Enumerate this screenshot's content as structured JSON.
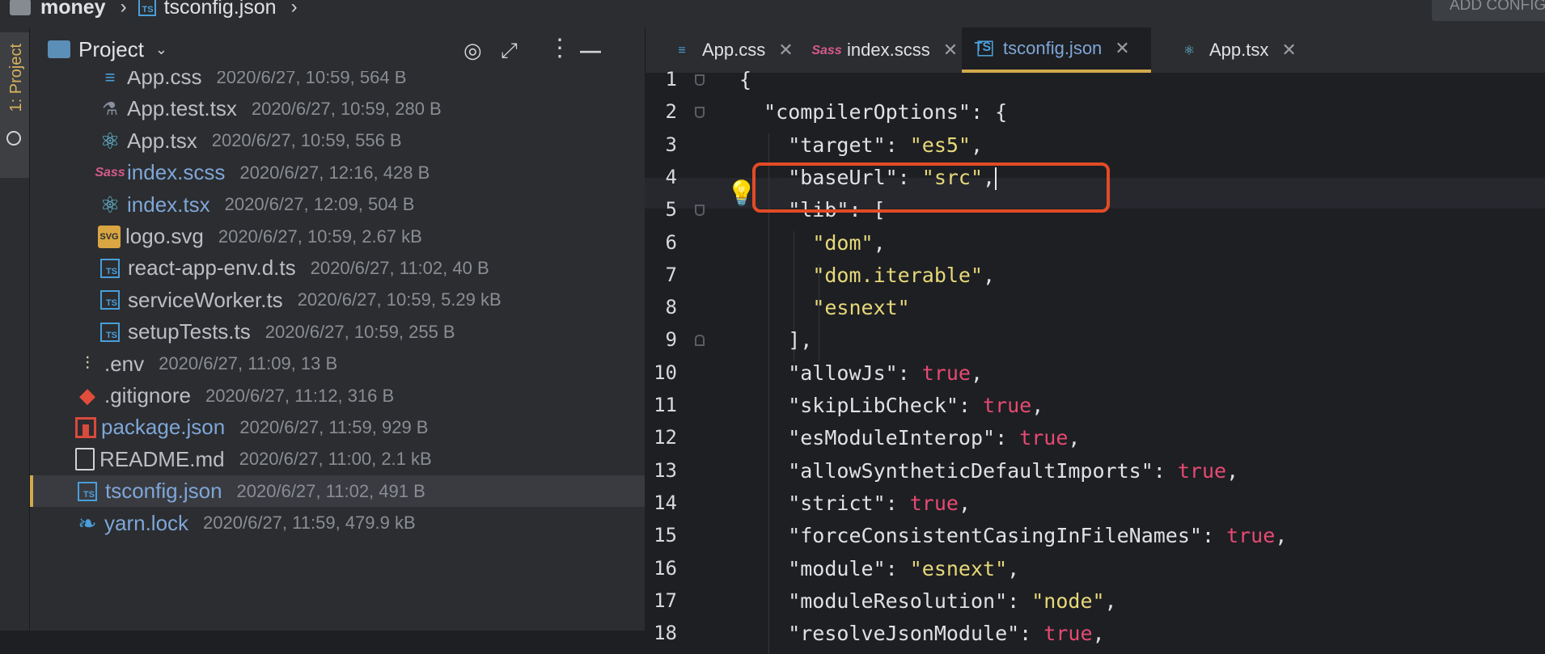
{
  "breadcrumb": {
    "project": "money",
    "file": "tsconfig.json",
    "ts_badge": "TS"
  },
  "toolbar": {
    "add_config": "ADD CONFIGURATION"
  },
  "tool_strip": {
    "project_label": "1: Project"
  },
  "project_panel": {
    "title": "Project"
  },
  "tree": [
    {
      "name": "App.css",
      "meta": "2020/6/27, 10:59, 564 B",
      "icon": "css-icon",
      "color": "#bcbec4"
    },
    {
      "name": "App.test.tsx",
      "meta": "2020/6/27, 10:59, 280 B",
      "icon": "flask-icon",
      "color": "#bcbec4"
    },
    {
      "name": "App.tsx",
      "meta": "2020/6/27, 10:59, 556 B",
      "icon": "react-icon",
      "color": "#bcbec4"
    },
    {
      "name": "index.scss",
      "meta": "2020/6/27, 12:16, 428 B",
      "icon": "sass-icon",
      "color": "#7fa6d8"
    },
    {
      "name": "index.tsx",
      "meta": "2020/6/27, 12:09, 504 B",
      "icon": "react-icon",
      "color": "#7fa6d8"
    },
    {
      "name": "logo.svg",
      "meta": "2020/6/27, 10:59, 2.67 kB",
      "icon": "svg-icon",
      "color": "#bcbec4"
    },
    {
      "name": "react-app-env.d.ts",
      "meta": "2020/6/27, 11:02, 40 B",
      "icon": "typescript-icon",
      "color": "#bcbec4"
    },
    {
      "name": "serviceWorker.ts",
      "meta": "2020/6/27, 10:59, 5.29 kB",
      "icon": "typescript-icon",
      "color": "#bcbec4"
    },
    {
      "name": "setupTests.ts",
      "meta": "2020/6/27, 10:59, 255 B",
      "icon": "typescript-icon",
      "color": "#bcbec4"
    },
    {
      "name": ".env",
      "meta": "2020/6/27, 11:09, 13 B",
      "icon": "settings-sliders-icon",
      "color": "#bcbec4"
    },
    {
      "name": ".gitignore",
      "meta": "2020/6/27, 11:12, 316 B",
      "icon": "git-icon",
      "color": "#bcbec4"
    },
    {
      "name": "package.json",
      "meta": "2020/6/27, 11:59, 929 B",
      "icon": "npm-package-icon",
      "color": "#7fa6d8"
    },
    {
      "name": "README.md",
      "meta": "2020/6/27, 11:00, 2.1 kB",
      "icon": "book-icon",
      "color": "#bcbec4"
    },
    {
      "name": "tsconfig.json",
      "meta": "2020/6/27, 11:02, 491 B",
      "icon": "typescript-icon",
      "color": "#7fa6d8",
      "selected": true
    },
    {
      "name": "yarn.lock",
      "meta": "2020/6/27, 11:59, 479.9 kB",
      "icon": "yarn-icon",
      "color": "#7fa6d8"
    }
  ],
  "icon_glyphs": {
    "ts_badge": "TS",
    "svg_badge": "SVG",
    "sass_badge": "Sass"
  },
  "tabs": [
    {
      "label": "App.css",
      "icon": "css-icon"
    },
    {
      "label": "index.scss",
      "icon": "sass-icon"
    },
    {
      "label": "tsconfig.json",
      "icon": "typescript-icon",
      "active": true
    },
    {
      "label": "App.tsx",
      "icon": "react-icon"
    }
  ],
  "editor": {
    "current_line": 4,
    "line_numbers": [
      "1",
      "2",
      "3",
      "4",
      "5",
      "6",
      "7",
      "8",
      "9",
      "10",
      "11",
      "12",
      "13",
      "14",
      "15",
      "16",
      "17",
      "18"
    ],
    "lines": [
      [
        {
          "t": "{",
          "c": "k"
        }
      ],
      [
        {
          "t": "  \"compilerOptions\": {",
          "c": "k"
        }
      ],
      [
        {
          "t": "    \"target\": ",
          "c": "k"
        },
        {
          "t": "\"es5\"",
          "c": "s"
        },
        {
          "t": ",",
          "c": "k"
        }
      ],
      [
        {
          "t": "    \"baseUrl\": ",
          "c": "k"
        },
        {
          "t": "\"src\"",
          "c": "s"
        },
        {
          "t": ",",
          "c": "k"
        }
      ],
      [
        {
          "t": "    \"lib\": [",
          "c": "k"
        }
      ],
      [
        {
          "t": "      ",
          "c": "k"
        },
        {
          "t": "\"dom\"",
          "c": "s"
        },
        {
          "t": ",",
          "c": "k"
        }
      ],
      [
        {
          "t": "      ",
          "c": "k"
        },
        {
          "t": "\"dom.iterable\"",
          "c": "s"
        },
        {
          "t": ",",
          "c": "k"
        }
      ],
      [
        {
          "t": "      ",
          "c": "k"
        },
        {
          "t": "\"esnext\"",
          "c": "s"
        }
      ],
      [
        {
          "t": "    ],",
          "c": "k"
        }
      ],
      [
        {
          "t": "    \"allowJs\": ",
          "c": "k"
        },
        {
          "t": "true",
          "c": "b"
        },
        {
          "t": ",",
          "c": "k"
        }
      ],
      [
        {
          "t": "    \"skipLibCheck\": ",
          "c": "k"
        },
        {
          "t": "true",
          "c": "b"
        },
        {
          "t": ",",
          "c": "k"
        }
      ],
      [
        {
          "t": "    \"esModuleInterop\": ",
          "c": "k"
        },
        {
          "t": "true",
          "c": "b"
        },
        {
          "t": ",",
          "c": "k"
        }
      ],
      [
        {
          "t": "    \"allowSyntheticDefaultImports\": ",
          "c": "k"
        },
        {
          "t": "true",
          "c": "b"
        },
        {
          "t": ",",
          "c": "k"
        }
      ],
      [
        {
          "t": "    \"strict\": ",
          "c": "k"
        },
        {
          "t": "true",
          "c": "b"
        },
        {
          "t": ",",
          "c": "k"
        }
      ],
      [
        {
          "t": "    \"forceConsistentCasingInFileNames\": ",
          "c": "k"
        },
        {
          "t": "true",
          "c": "b"
        },
        {
          "t": ",",
          "c": "k"
        }
      ],
      [
        {
          "t": "    \"module\": ",
          "c": "k"
        },
        {
          "t": "\"esnext\"",
          "c": "s"
        },
        {
          "t": ",",
          "c": "k"
        }
      ],
      [
        {
          "t": "    \"moduleResolution\": ",
          "c": "k"
        },
        {
          "t": "\"node\"",
          "c": "s"
        },
        {
          "t": ",",
          "c": "k"
        }
      ],
      [
        {
          "t": "    \"resolveJsonModule\": ",
          "c": "k"
        },
        {
          "t": "true",
          "c": "b"
        },
        {
          "t": ",",
          "c": "k"
        }
      ]
    ]
  },
  "colors": {
    "accent": "#d2a94c",
    "highlight_box": "#e24b26",
    "link_blue": "#7fa6d8"
  }
}
